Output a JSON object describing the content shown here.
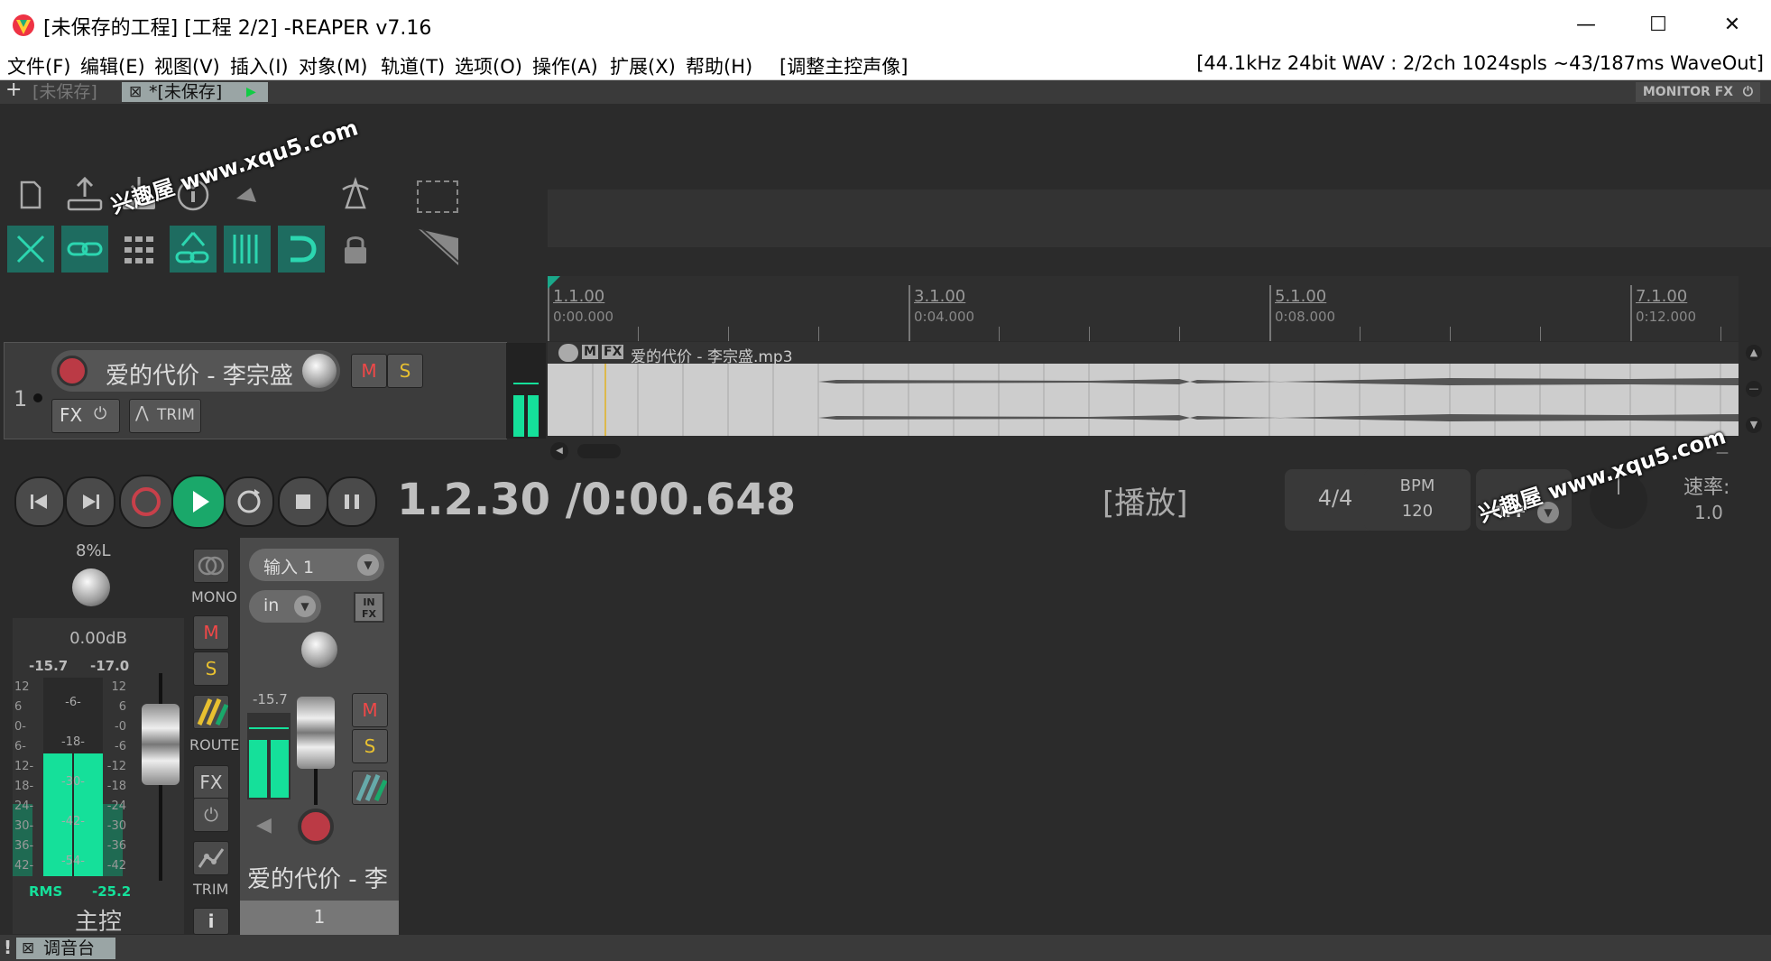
{
  "window": {
    "title": "[未保存的工程] [工程 2/2] -REAPER v7.16",
    "min_glyph": "—",
    "max_glyph": "☐",
    "close_glyph": "✕"
  },
  "menubar": {
    "items": [
      "文件(F)",
      "编辑(E)",
      "视图(V)",
      "插入(I)",
      "对象(M)",
      "轨道(T)",
      "选项(O)",
      "操作(A)",
      "扩展(X)",
      "帮助(H)",
      "[调整主控声像]"
    ],
    "status_info": "[44.1kHz 24bit WAV : 2/2ch 1024spls ~43/187ms WaveOut]"
  },
  "tabs": {
    "add_glyph": "+",
    "items": [
      {
        "label": "[未保存]",
        "active": false
      },
      {
        "label": "*[未保存]",
        "active": true
      }
    ],
    "monitor_fx": "MONITOR FX"
  },
  "toolbar": {
    "row1": [
      "new-project-icon",
      "upload-icon",
      "download-icon",
      "info-icon",
      "cursor-icon",
      "metronome-icon"
    ],
    "row2": [
      {
        "name": "ripple-icon",
        "active": true
      },
      {
        "name": "link-icon",
        "active": true
      },
      {
        "name": "grid-icon",
        "active": false
      },
      {
        "name": "group-link-icon",
        "active": true
      },
      {
        "name": "snap-grid-icon",
        "active": true
      },
      {
        "name": "snap-magnet-icon",
        "active": true
      },
      {
        "name": "lock-icon",
        "active": false
      }
    ]
  },
  "ruler": {
    "markers": [
      {
        "bar": "1.1.00",
        "time": "0:00.000"
      },
      {
        "bar": "3.1.00",
        "time": "0:04.000"
      },
      {
        "bar": "5.1.00",
        "time": "0:08.000"
      },
      {
        "bar": "7.1.00",
        "time": "0:12.000"
      }
    ]
  },
  "track": {
    "number": "1",
    "name": "爱的代价 - 李宗盛",
    "mute_label": "M",
    "solo_label": "S",
    "fx_label": "FX",
    "trim_label": "TRIM",
    "item_name": "爱的代价 - 李宗盛.mp3",
    "item_badges": [
      "M",
      "FX"
    ]
  },
  "transport": {
    "position": "1.2.30 /0:00.648",
    "state": "[播放]",
    "time_sig": "4/4",
    "bpm_label": "BPM",
    "bpm_value": "120",
    "playrate_label": "速率:",
    "playrate_value": "1.0",
    "off_label": "OFF"
  },
  "master": {
    "pan_value": "8%L",
    "volume_db": "0.00dB",
    "peak_left": "-15.7",
    "peak_right": "-17.0",
    "rms_label": "RMS",
    "rms_value": "-25.2",
    "name": "主控",
    "mono_label": "MONO",
    "route_label": "ROUTE",
    "trim_label": "TRIM",
    "fx_label": "FX",
    "mute_label": "M",
    "solo_label": "S",
    "info_label": "i",
    "left_level": 0.62,
    "right_level": 0.6,
    "scale_left": [
      "12",
      "6",
      "0-",
      "6-",
      "12-",
      "18-",
      "24-",
      "30-",
      "36-",
      "42-"
    ],
    "scale_right": [
      "12",
      "6",
      "-0",
      "-6",
      "-12",
      "-18",
      "-24",
      "-30",
      "-36",
      "-42"
    ],
    "scale_mid": [
      "-6-",
      "-18-",
      "-30-",
      "-42-",
      "-54-"
    ]
  },
  "channel": {
    "input_label": "输入 1",
    "in_label": "in",
    "infx_label": "IN FX",
    "peak": "-15.7",
    "mute_label": "M",
    "solo_label": "S",
    "name": "爱的代价 - 李",
    "number": "1",
    "level": 0.55
  },
  "bottom_tab": {
    "bang": "!",
    "label": "调音台"
  },
  "watermark": "兴趣屋 www.xqu5.com",
  "colors": {
    "accent_teal": "#1e6c60",
    "meter_green": "#15e09a",
    "play_green": "#1aa86a",
    "record_red": "#c8404a"
  }
}
